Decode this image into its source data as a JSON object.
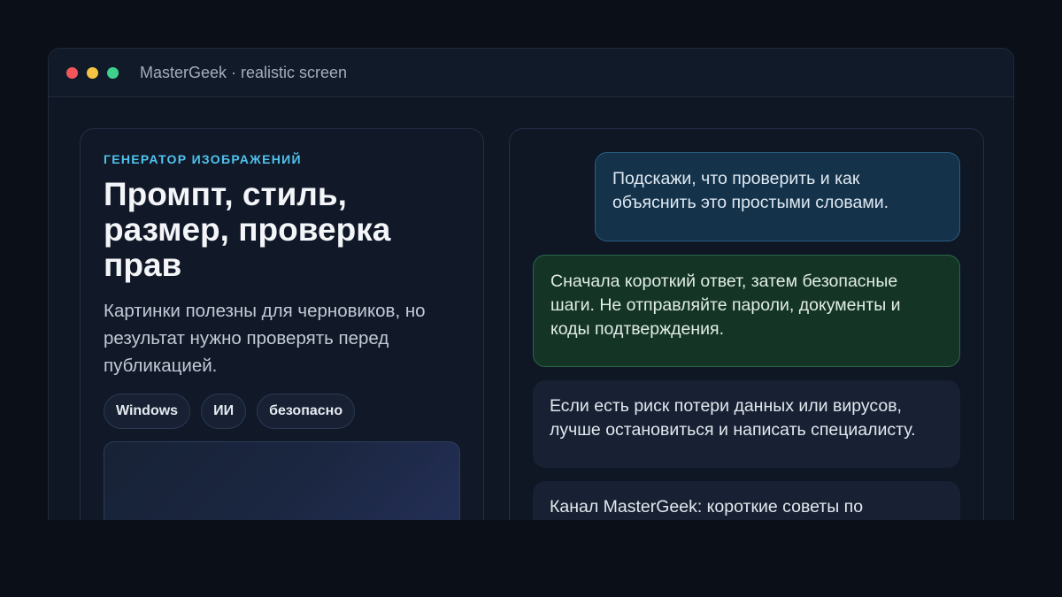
{
  "window": {
    "title": "MasterGeek · realistic screen"
  },
  "left": {
    "eyebrow": "ГЕНЕРАТОР ИЗОБРАЖЕНИЙ",
    "headline": "Промпт, стиль, размер, проверка прав",
    "lead": "Картинки полезны для черновиков, но результат нужно проверять перед публикацией.",
    "tags": [
      "Windows",
      "ИИ",
      "безопасно"
    ]
  },
  "chat": {
    "messages": [
      "Подскажи, что проверить и как объяснить это простыми словами.",
      "Сначала короткий ответ, затем безопасные шаги. Не отправляйте пароли, документы и коды подтверждения.",
      "Если есть риск потери данных или вирусов, лучше остановиться и написать специалисту.",
      "Канал MasterGeek: короткие советы по"
    ]
  },
  "colors": {
    "accent": "#4fc3ef",
    "user_bubble": "#14324a",
    "assistant_bubble": "#143426",
    "close": "#f2555a",
    "minimize": "#f6c344",
    "maximize": "#3fd08e"
  }
}
